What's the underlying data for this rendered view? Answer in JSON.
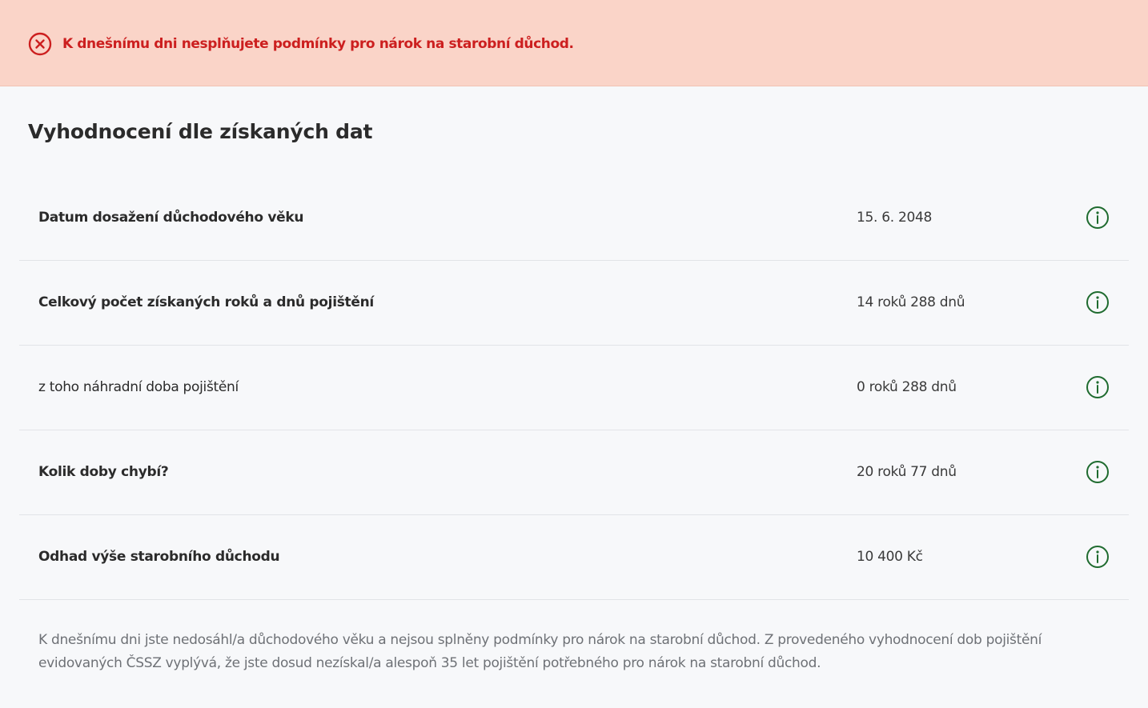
{
  "alert": {
    "icon": "error-circle-x-icon",
    "color": "#cc1f1f",
    "background": "#fad4c8",
    "message": "K dnešnímu dni nesplňujete podmínky pro nárok na starobní důchod."
  },
  "section": {
    "title": "Vyhodnocení dle získaných dat"
  },
  "rows": [
    {
      "label": "Datum dosažení důchodového věku",
      "value": "15. 6. 2048",
      "bold": true,
      "icon": "info-icon"
    },
    {
      "label": "Celkový počet získaných roků a dnů pojištění",
      "value": "14 roků 288 dnů",
      "bold": true,
      "icon": "info-icon"
    },
    {
      "label": "z toho náhradní doba pojištění",
      "value": "0 roků 288 dnů",
      "bold": false,
      "icon": "info-icon"
    },
    {
      "label": "Kolik doby chybí?",
      "value": "20 roků 77 dnů",
      "bold": true,
      "icon": "info-icon"
    },
    {
      "label": "Odhad výše starobního důchodu",
      "value": "10 400 Kč",
      "bold": true,
      "icon": "info-icon"
    }
  ],
  "info_icon_color": "#1f6b2f",
  "footnote": "K dnešnímu dni jste nedosáhl/a důchodového věku a nejsou splněny podmínky pro nárok na starobní důchod. Z provedeného vyhodnocení dob pojištění evidovaných ČSSZ vyplývá, že jste dosud nezískal/a alespoň 35 let pojištění potřebného pro nárok na starobní důchod."
}
